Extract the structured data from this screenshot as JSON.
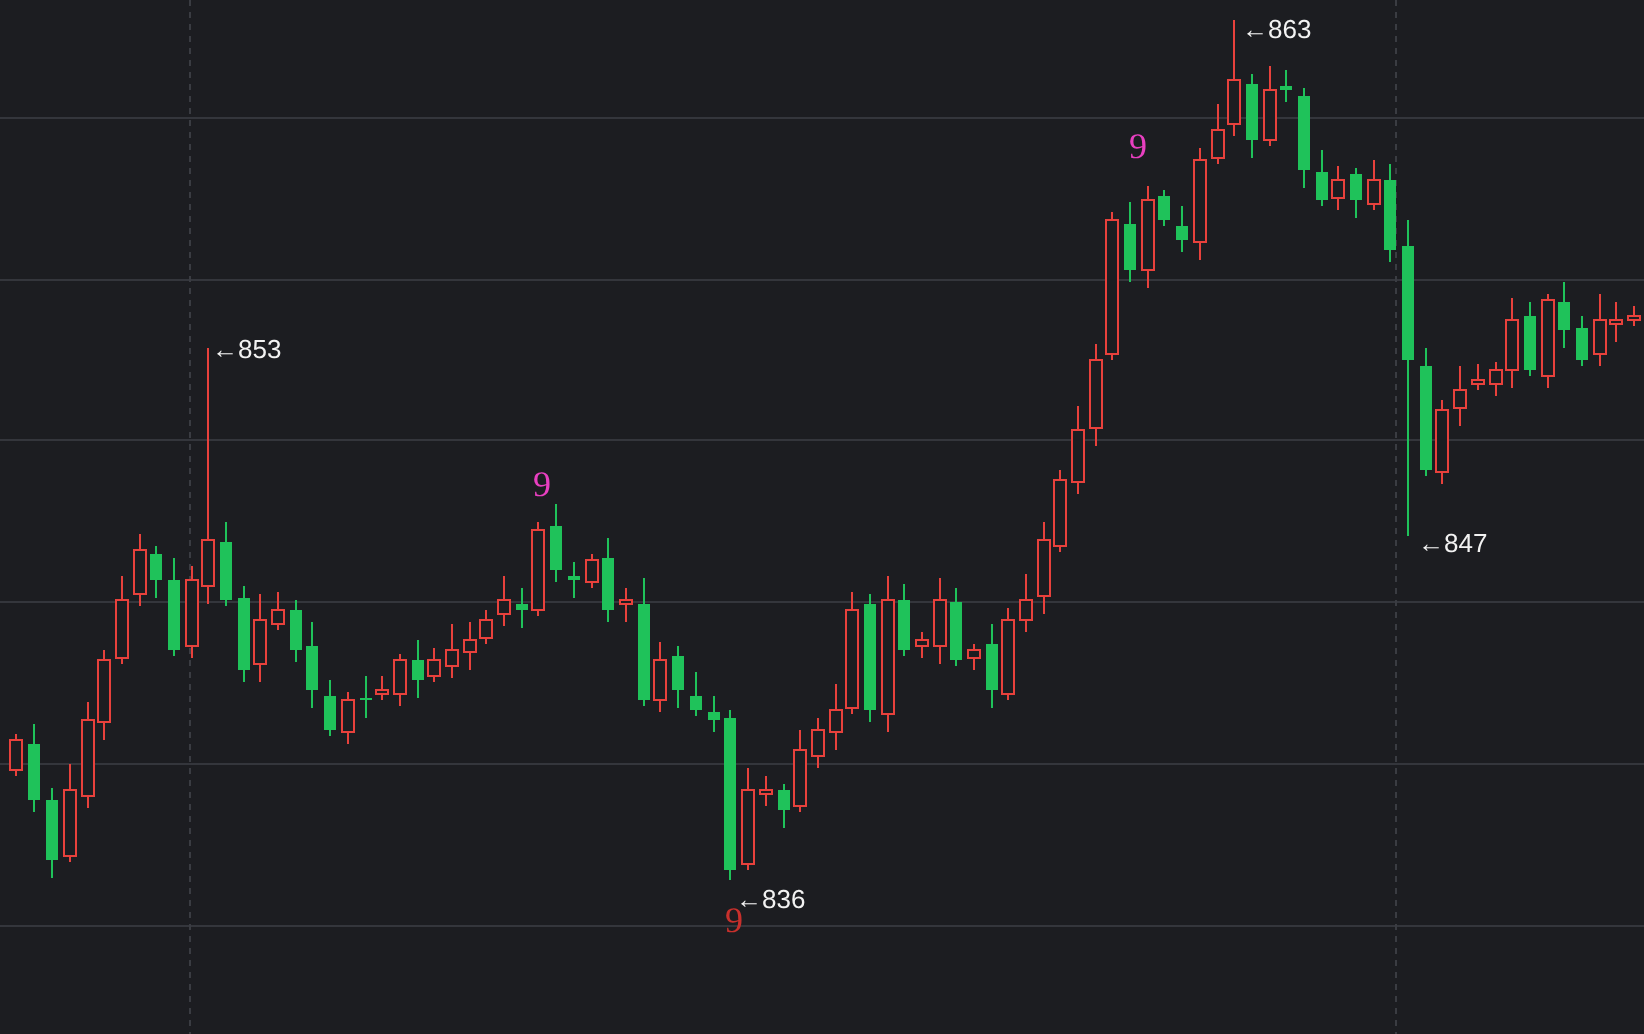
{
  "chart": {
    "extreme_labels": [
      {
        "text": "←853"
      },
      {
        "text": "←863"
      },
      {
        "text": "←836"
      },
      {
        "text": "←847"
      }
    ],
    "count_marks": [
      {
        "text": "9",
        "color": "#e83fc0"
      },
      {
        "text": "9",
        "color": "#e83fc0"
      },
      {
        "text": "9",
        "color": "#c8302c"
      }
    ]
  }
}
